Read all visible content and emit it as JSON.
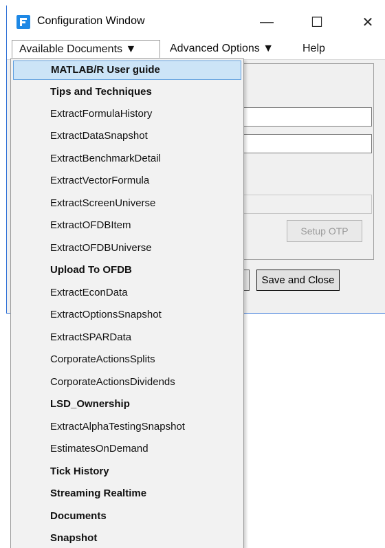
{
  "window": {
    "title": "Configuration Window",
    "controls": {
      "minimize": "—",
      "maximize": "☐",
      "close": "✕"
    }
  },
  "menubar": {
    "items": [
      {
        "label": "Available Documents ▼"
      },
      {
        "label": "Advanced Options ▼"
      },
      {
        "label": "Help"
      }
    ]
  },
  "form": {
    "setup_otp_label": "Setup OTP",
    "save_close_label": "Save and Close"
  },
  "dropdown": {
    "items": [
      {
        "label": "MATLAB/R User guide",
        "highlighted": true
      },
      {
        "label": "Tips and Techniques"
      },
      {
        "label": "ExtractFormulaHistory"
      },
      {
        "label": "ExtractDataSnapshot"
      },
      {
        "label": "ExtractBenchmarkDetail"
      },
      {
        "label": "ExtractVectorFormula"
      },
      {
        "label": "ExtractScreenUniverse"
      },
      {
        "label": "ExtractOFDBItem"
      },
      {
        "label": "ExtractOFDBUniverse"
      },
      {
        "label": "Upload To OFDB"
      },
      {
        "label": "ExtractEconData"
      },
      {
        "label": "ExtractOptionsSnapshot"
      },
      {
        "label": "ExtractSPARData"
      },
      {
        "label": "CorporateActionsSplits"
      },
      {
        "label": "CorporateActionsDividends"
      },
      {
        "label": "LSD_Ownership"
      },
      {
        "label": "ExtractAlphaTestingSnapshot"
      },
      {
        "label": "EstimatesOnDemand"
      },
      {
        "label": "Tick History"
      },
      {
        "label": "Streaming Realtime"
      },
      {
        "label": "Documents"
      },
      {
        "label": "Snapshot"
      }
    ]
  },
  "colors": {
    "accent_logo": "#1e88e5",
    "highlight_bg": "#cce4f7",
    "highlight_border": "#5fa0e0",
    "window_border": "#2e6fd6"
  },
  "icons": {
    "app_logo": "factset-f-logo-icon"
  }
}
